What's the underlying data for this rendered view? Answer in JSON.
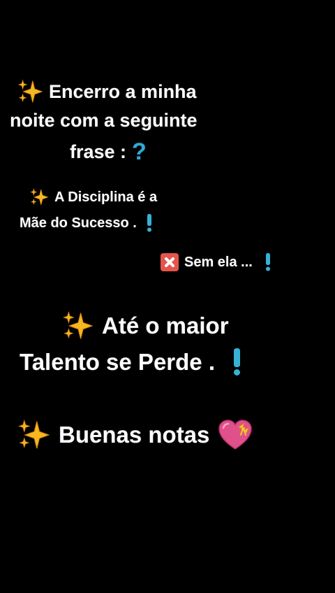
{
  "block1": {
    "line1": "Encerro a minha",
    "line2": "noite com a seguinte",
    "line3": "frase :",
    "line3_mark": "?"
  },
  "block2": {
    "line1": "A Disciplina é a",
    "line2": "Mãe do Sucesso ."
  },
  "block3": {
    "line1": "Sem ela ..."
  },
  "block4": {
    "line1": "Até o maior",
    "line2": "Talento se Perde ."
  },
  "block5": {
    "line1": "Buenas notas"
  },
  "icons": {
    "sparkles": "sparkles-icon",
    "question": "question-mark-icon",
    "exclamation": "exclamation-mark-icon",
    "cross": "cross-mark-icon",
    "heart": "heart-with-ribbon-icon"
  },
  "colors": {
    "background": "#000000",
    "text": "#ffffff",
    "sparkle": "#f5b820",
    "mark_blue": "#34b3d6",
    "cross_red": "#e4554b",
    "heart_pink": "#e0508a",
    "ribbon_yellow": "#f7c72c"
  }
}
